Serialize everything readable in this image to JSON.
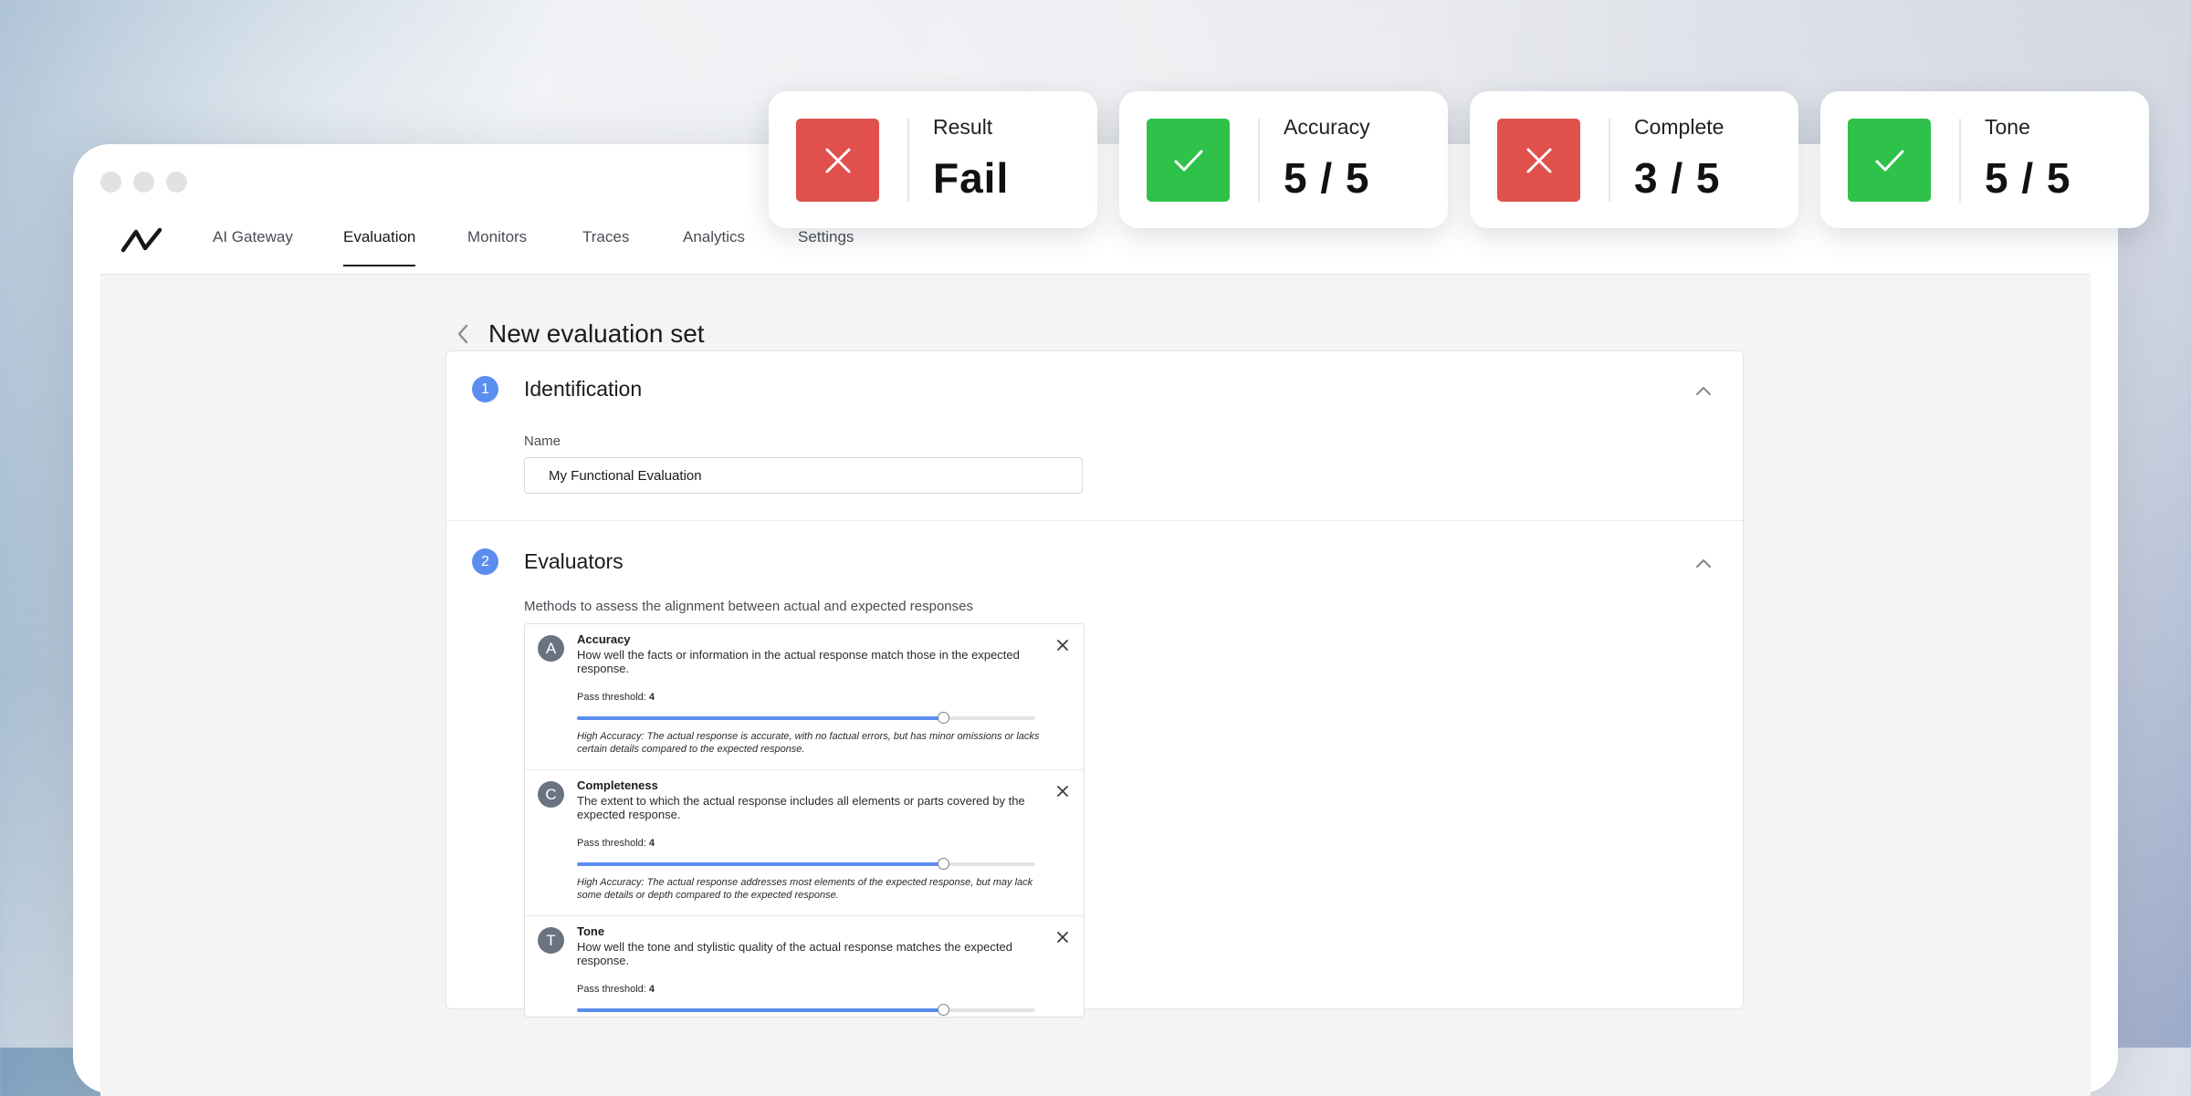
{
  "nav": {
    "items": [
      {
        "label": "AI Gateway"
      },
      {
        "label": "Evaluation",
        "active": true
      },
      {
        "label": "Monitors"
      },
      {
        "label": "Traces"
      },
      {
        "label": "Analytics"
      },
      {
        "label": "Settings"
      }
    ]
  },
  "page": {
    "title": "New evaluation set"
  },
  "identification": {
    "step": "1",
    "title": "Identification",
    "name_label": "Name",
    "name_value": "My Functional Evaluation"
  },
  "evaluators": {
    "step": "2",
    "title": "Evaluators",
    "description": "Methods to assess the alignment between actual and expected responses",
    "items": [
      {
        "initial": "A",
        "name": "Accuracy",
        "description": "How well the facts or information in the actual response match those in the expected response.",
        "threshold_label": "Pass threshold:",
        "threshold": "4",
        "slider_fraction": 0.8,
        "note": "High Accuracy: The actual response is accurate, with no factual errors, but has minor omissions or lacks certain details compared to the expected response."
      },
      {
        "initial": "C",
        "name": "Completeness",
        "description": "The extent to which the actual response includes all elements or parts covered by the expected response.",
        "threshold_label": "Pass threshold:",
        "threshold": "4",
        "slider_fraction": 0.8,
        "note": "High Accuracy: The actual response addresses most elements of the expected response, but may lack some details or depth compared to the expected response."
      },
      {
        "initial": "T",
        "name": "Tone",
        "description": "How well the tone and stylistic quality of the actual response matches the expected response.",
        "threshold_label": "Pass threshold:",
        "threshold": "4",
        "slider_fraction": 0.8,
        "note": ""
      }
    ]
  },
  "metrics": [
    {
      "label": "Result",
      "value": "Fail",
      "status": "fail",
      "icon": "x-icon"
    },
    {
      "label": "Accuracy",
      "value": "5 / 5",
      "status": "pass",
      "icon": "check-icon"
    },
    {
      "label": "Complete",
      "value": "3 / 5",
      "status": "fail",
      "icon": "x-icon"
    },
    {
      "label": "Tone",
      "value": "5 / 5",
      "status": "pass",
      "icon": "check-icon"
    }
  ],
  "colors": {
    "accent": "#5b8def",
    "fail": "#e0504c",
    "pass": "#2ec24a"
  }
}
